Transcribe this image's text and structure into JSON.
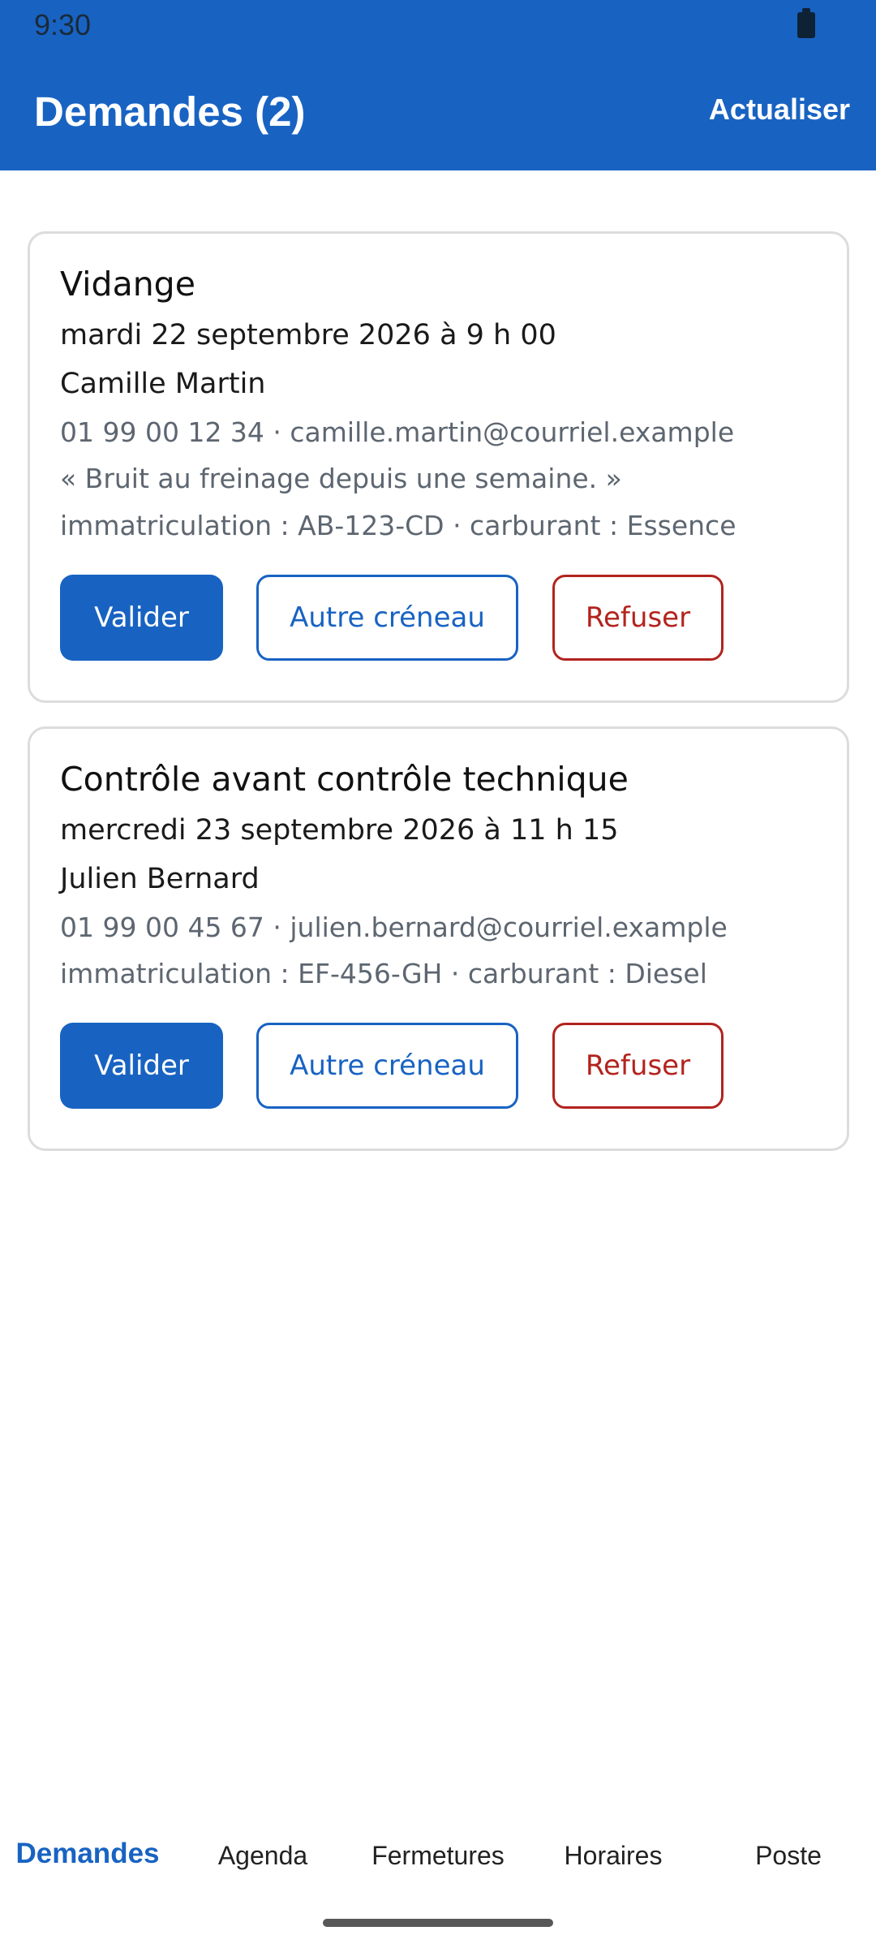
{
  "status_bar": {
    "time": "9:30",
    "battery_icon": "battery-full-icon"
  },
  "app_bar": {
    "title": "Demandes (2)",
    "refresh_label": "Actualiser"
  },
  "requests": [
    {
      "service": "Vidange",
      "datetime": "mardi 22 septembre 2026 à 9 h 00",
      "customer": "Camille Martin",
      "contact": "01 99 00 12 34 · camille.martin@courriel.example",
      "comment": "« Bruit au freinage depuis une semaine. »",
      "vehicle": "immatriculation : AB-123-CD · carburant : Essence",
      "actions": {
        "accept": "Valider",
        "reschedule": "Autre créneau",
        "refuse": "Refuser"
      }
    },
    {
      "service": "Contrôle avant contrôle technique",
      "datetime": "mercredi 23 septembre 2026 à 11 h 15",
      "customer": "Julien Bernard",
      "contact": "01 99 00 45 67 · julien.bernard@courriel.example",
      "vehicle": "immatriculation : EF-456-GH · carburant : Diesel",
      "actions": {
        "accept": "Valider",
        "reschedule": "Autre créneau",
        "refuse": "Refuser"
      }
    }
  ],
  "bottom_nav": {
    "items": [
      {
        "label": "Demandes",
        "active": true
      },
      {
        "label": "Agenda"
      },
      {
        "label": "Fermetures"
      },
      {
        "label": "Horaires"
      },
      {
        "label": "Poste"
      }
    ]
  },
  "colors": {
    "primary": "#1863c2",
    "danger": "#b3231e",
    "secondary_text": "#5d6670"
  }
}
